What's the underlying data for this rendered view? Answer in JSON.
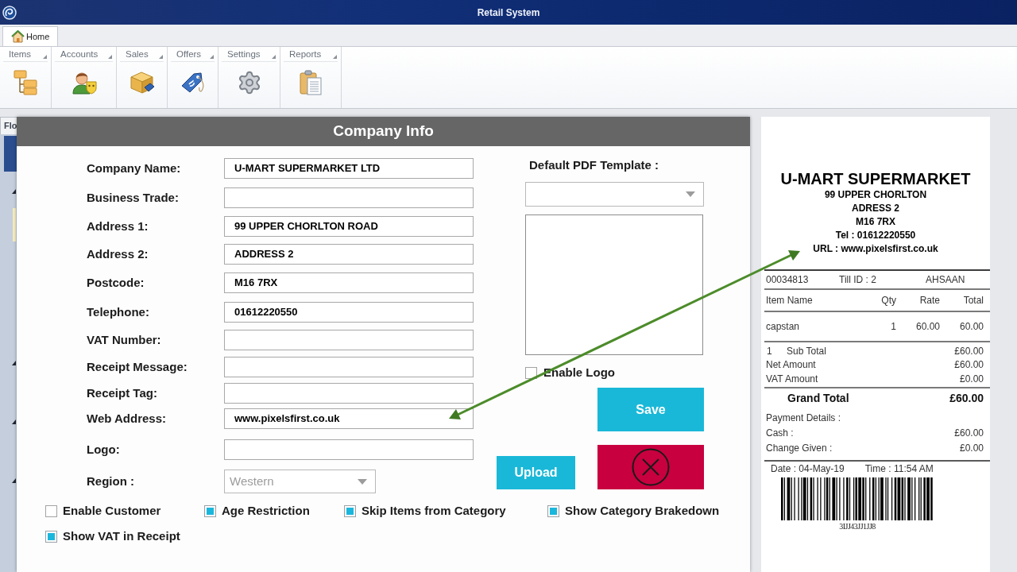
{
  "window": {
    "title": "Retail System"
  },
  "ribbon": {
    "tabs": [
      {
        "label": "Home",
        "selected": true
      }
    ],
    "groups": [
      {
        "label": "Items"
      },
      {
        "label": "Accounts"
      },
      {
        "label": "Sales"
      },
      {
        "label": "Offers"
      },
      {
        "label": "Settings"
      },
      {
        "label": "Reports"
      }
    ]
  },
  "side_panel": {
    "tab": "Flo"
  },
  "dialog": {
    "title": "Company Info",
    "fields": [
      {
        "label": "Company Name:",
        "value": "U-MART SUPERMARKET LTD"
      },
      {
        "label": "Business Trade:"
      },
      {
        "label": "Address 1:",
        "value": "99 UPPER CHORLTON ROAD"
      },
      {
        "label": "Address 2:",
        "value": "ADDRESS 2"
      },
      {
        "label": "Postcode:",
        "value": "M16 7RX"
      },
      {
        "label": "Telephone:",
        "value": "01612220550"
      },
      {
        "label": "VAT Number:"
      },
      {
        "label": "Receipt Message:"
      },
      {
        "label": "Receipt Tag:"
      },
      {
        "label": "Web Address:",
        "value": "www.pixelsfirst.co.uk"
      },
      {
        "label": "Logo:"
      }
    ],
    "region": {
      "label": "Region :",
      "value": "Western",
      "disabled": true
    },
    "pdf_template": {
      "label": "Default PDF Template :"
    },
    "enable_logo": {
      "label": "Enable Logo",
      "checked": false
    },
    "upload_button": {
      "label": "Upload"
    },
    "save_button": {
      "label": "Save"
    },
    "options": [
      {
        "label": "Enable Customer",
        "checked": false
      },
      {
        "label": "Age Restriction",
        "checked": true
      },
      {
        "label": "Skip Items from Category",
        "checked": true
      },
      {
        "label": "Show Category Brakedown",
        "checked": true
      },
      {
        "label": "Show VAT in Receipt",
        "checked": true
      }
    ]
  },
  "receipt": {
    "store_name": "U-MART SUPERMARKET",
    "header_lines": [
      "99 UPPER CHORLTON",
      "ADRESS 2",
      "M16 7RX",
      "Tel : 01612220550",
      "URL : www.pixelsfirst.co.uk"
    ],
    "info": [
      "00034813",
      "Till ID : 2",
      "AHSAAN"
    ],
    "columns": [
      "Item Name",
      "Qty",
      "Rate",
      "Total"
    ],
    "items": [
      {
        "name": "capstan",
        "qty": "1",
        "rate": "60.00",
        "total": "60.00"
      }
    ],
    "totals": [
      {
        "count": "1",
        "label": "Sub Total",
        "value": "£60.00"
      },
      {
        "label": "Net Amount",
        "value": "£60.00"
      },
      {
        "label": "VAT Amount",
        "value": "£0.00"
      }
    ],
    "grand_total": {
      "label": "Grand Total",
      "value": "£60.00"
    },
    "payment_title": "Payment Details :",
    "payments": [
      {
        "label": "Cash :",
        "value": "£60.00"
      },
      {
        "label": "Change Given :",
        "value": "£0.00"
      }
    ],
    "date": "Date : 04-May-19",
    "time": "Time : 11:54 AM",
    "barcode_text": "3IJJ43JJ1JJ8"
  }
}
